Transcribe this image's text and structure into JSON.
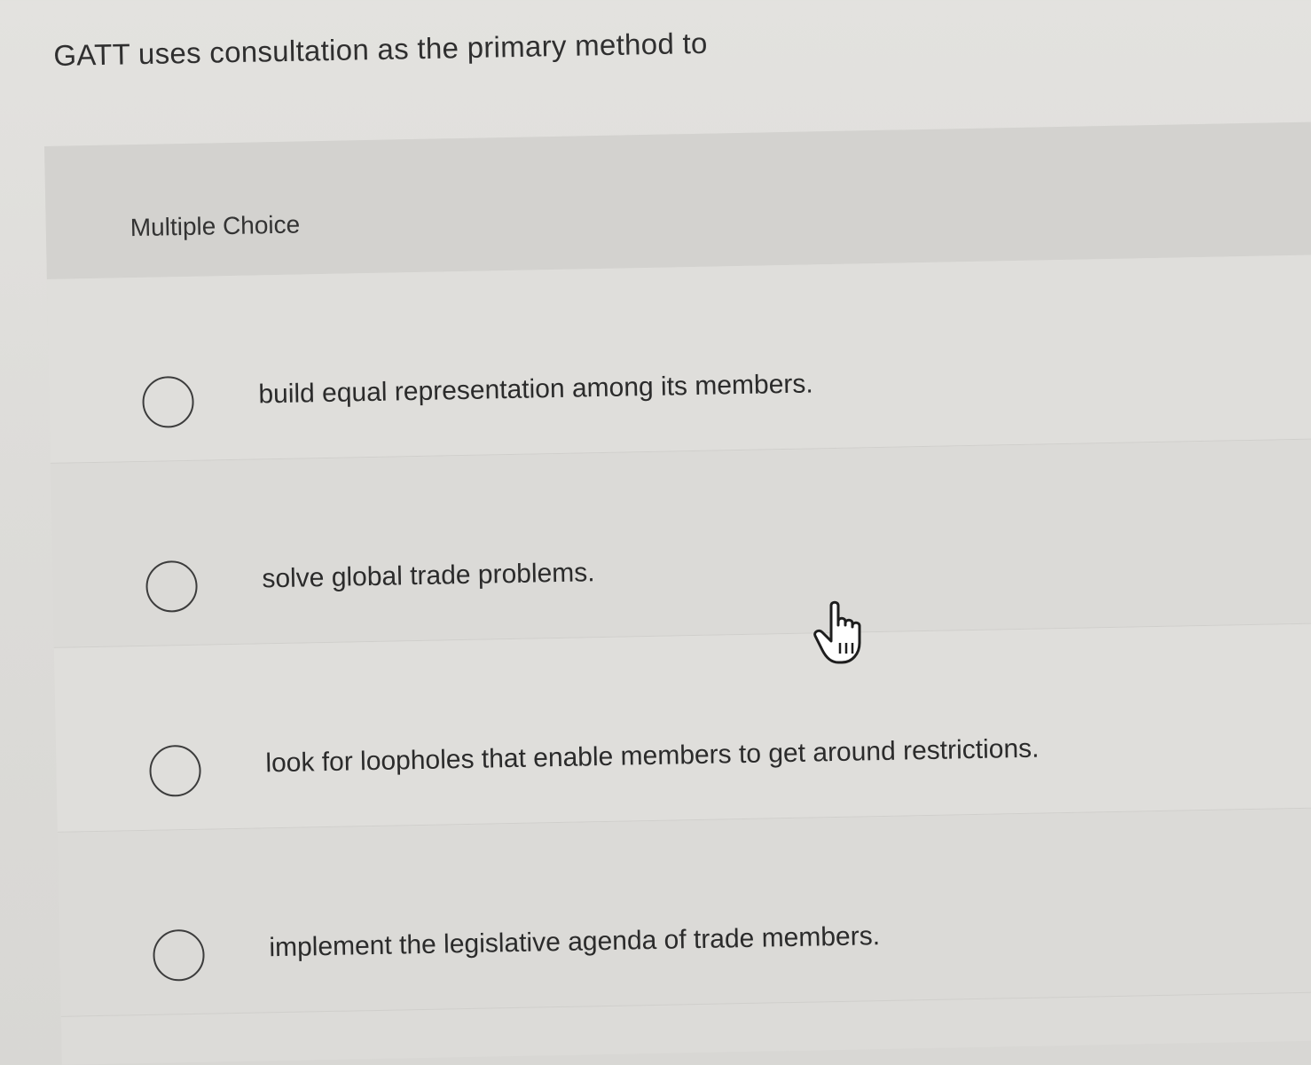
{
  "question": {
    "text": "GATT uses consultation as the primary method to"
  },
  "panel": {
    "title": "Multiple Choice"
  },
  "options": [
    {
      "label": "build equal representation among its members.",
      "selected": false
    },
    {
      "label": "solve global trade problems.",
      "selected": false
    },
    {
      "label": "look for loopholes that enable members to get around restrictions.",
      "selected": false
    },
    {
      "label": "implement the legislative agenda of trade members.",
      "selected": false
    }
  ],
  "cursor": {
    "icon": "hand-pointer-icon"
  }
}
